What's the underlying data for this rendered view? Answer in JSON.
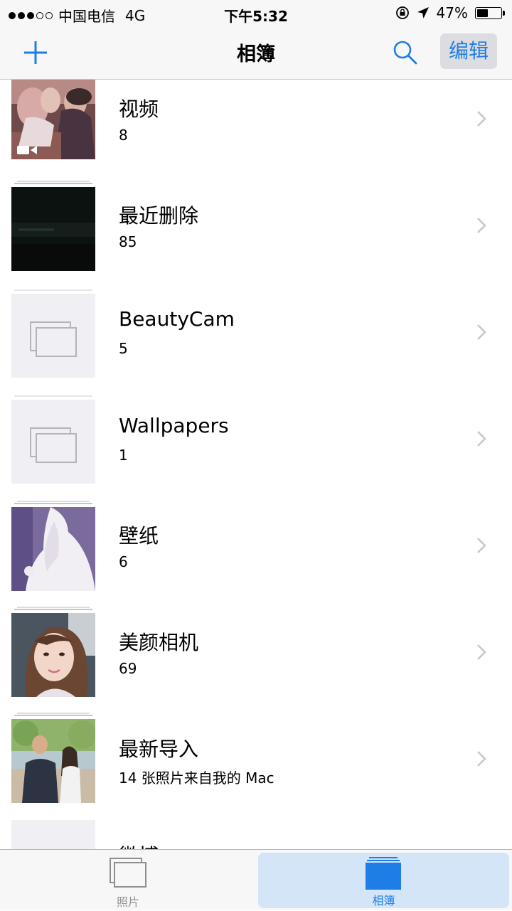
{
  "status": {
    "carrier": "中国电信",
    "network": "4G",
    "time": "下午5:32",
    "battery": "47%",
    "battery_level": 0.47
  },
  "nav": {
    "title": "相簿",
    "edit_label": "编辑",
    "add_icon": "plus-icon",
    "search_icon": "search-icon"
  },
  "albums": [
    {
      "name": "视频",
      "count": "8",
      "thumb": "photo-video"
    },
    {
      "name": "最近删除",
      "count": "85",
      "thumb": "photo-dark"
    },
    {
      "name": "BeautyCam",
      "count": "5",
      "thumb": "empty-album"
    },
    {
      "name": "Wallpapers",
      "count": "1",
      "thumb": "empty-album"
    },
    {
      "name": "壁纸",
      "count": "6",
      "thumb": "photo-dress"
    },
    {
      "name": "美颜相机",
      "count": "69",
      "thumb": "photo-portrait"
    },
    {
      "name": "最新导入",
      "count": "14 张照片来自我的 Mac",
      "thumb": "photo-outdoor"
    },
    {
      "name": "微博",
      "count": "",
      "thumb": "empty-album"
    }
  ],
  "tabs": [
    {
      "label": "照片",
      "icon": "photos-icon",
      "selected": false
    },
    {
      "label": "相簿",
      "icon": "albums-icon",
      "selected": true
    }
  ],
  "colors": {
    "accent": "#1f7de6",
    "bar_background": "#f7f7f7",
    "selected_tab": "#d3e5f7"
  }
}
